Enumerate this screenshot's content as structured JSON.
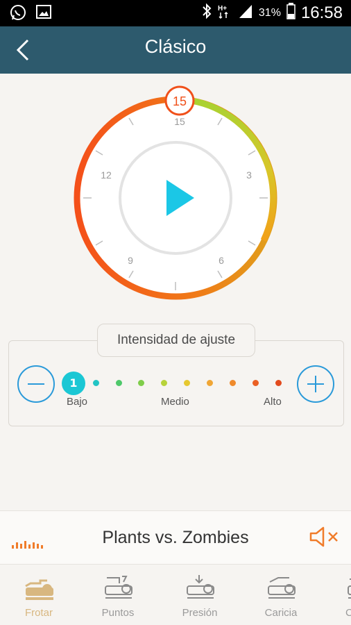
{
  "status_bar": {
    "battery_percent": "31%",
    "time": "16:58",
    "network": "H+"
  },
  "app_bar": {
    "title": "Clásico"
  },
  "timer": {
    "value": "15",
    "dial_labels": [
      "15",
      "3",
      "6",
      "9",
      "12"
    ]
  },
  "intensity": {
    "title": "Intensidad de ajuste",
    "current_level": "1",
    "labels": {
      "low": "Bajo",
      "mid": "Medio",
      "high": "Alto"
    },
    "dot_colors": [
      "#22c4c4",
      "#4ec86a",
      "#7fcd4a",
      "#b7d23a",
      "#e6c830",
      "#f0a635",
      "#ef8a2c",
      "#ea6024",
      "#e24b1e"
    ]
  },
  "now_playing": {
    "title": "Plants vs. Zombies"
  },
  "colors": {
    "accent": "#1bc7d4",
    "app_bar": "#2d5a6d",
    "timer_ring_warm": "#f05a12",
    "timer_ring_cool": "#a8d232",
    "mute": "#f07c2a"
  },
  "bottom_nav": {
    "items": [
      {
        "label": "Frotar",
        "icon": "massage-rub-icon",
        "active": true
      },
      {
        "label": "Puntos",
        "icon": "massage-points-icon",
        "active": false
      },
      {
        "label": "Presión",
        "icon": "massage-press-icon",
        "active": false
      },
      {
        "label": "Caricia",
        "icon": "massage-caress-icon",
        "active": false
      },
      {
        "label": "C",
        "icon": "massage-more-icon",
        "active": false
      }
    ]
  }
}
